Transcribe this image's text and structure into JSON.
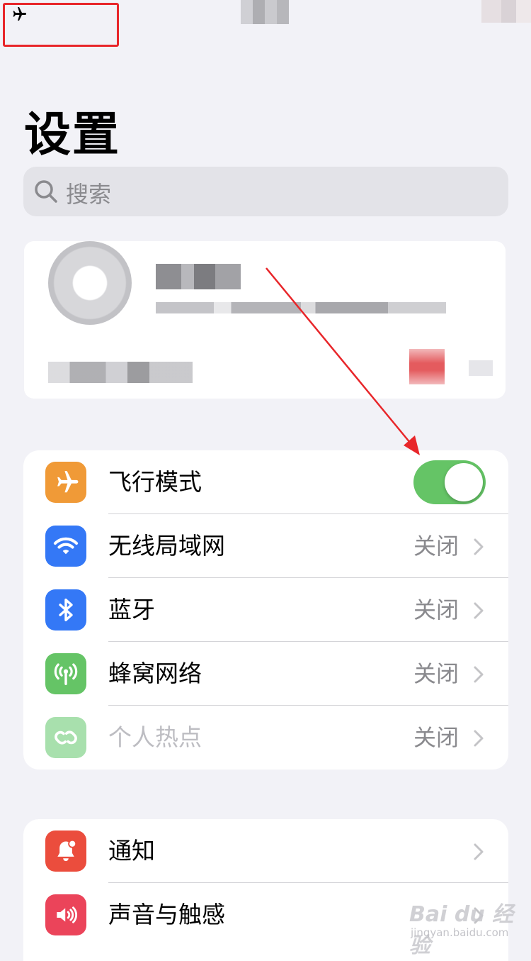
{
  "page": {
    "title": "设置"
  },
  "search": {
    "placeholder": "搜索"
  },
  "colors": {
    "background": "#f2f2f7",
    "airplane": "#f09a37",
    "wifi": "#3478f6",
    "bluetooth": "#3478f6",
    "cellular": "#65c466",
    "hotspot": "#a8e0ad",
    "notifications": "#eb4d3d",
    "sounds": "#eb445a",
    "toggle_on": "#65c466",
    "annotation": "#e8262a"
  },
  "connectivity": {
    "airplane": {
      "label": "飞行模式",
      "icon": "airplane-icon",
      "toggle_on": true
    },
    "wifi": {
      "label": "无线局域网",
      "value": "关闭",
      "icon": "wifi-icon"
    },
    "bluetooth": {
      "label": "蓝牙",
      "value": "关闭",
      "icon": "bluetooth-icon"
    },
    "cellular": {
      "label": "蜂窝网络",
      "value": "关闭",
      "icon": "cellular-icon"
    },
    "hotspot": {
      "label": "个人热点",
      "value": "关闭",
      "icon": "hotspot-icon",
      "disabled": true
    }
  },
  "system": {
    "notifications": {
      "label": "通知",
      "icon": "bell-icon"
    },
    "sounds": {
      "label": "声音与触感",
      "icon": "speaker-icon"
    }
  },
  "watermark": {
    "brand": "Bai du 经验",
    "url": "jingyan.baidu.com"
  }
}
